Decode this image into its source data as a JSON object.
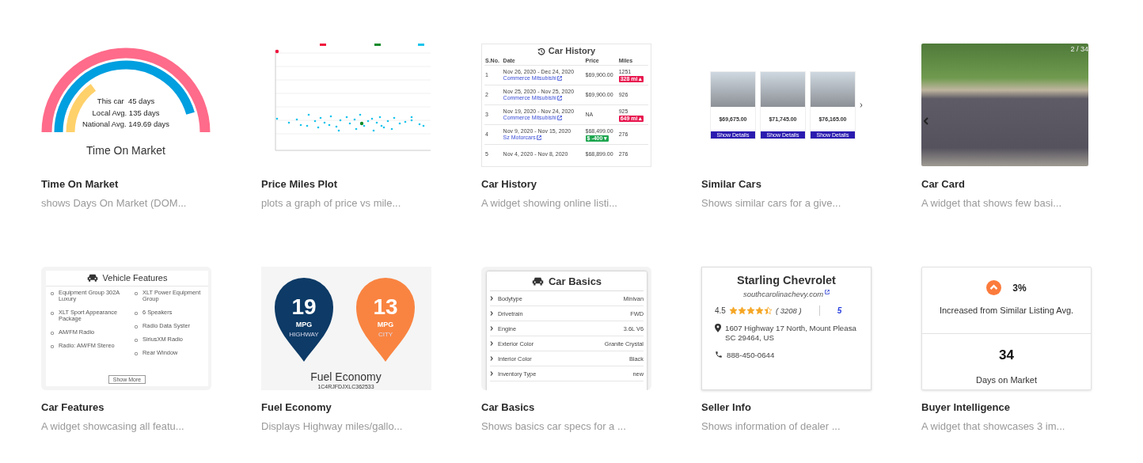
{
  "cards": [
    {
      "title": "Time On Market",
      "description": "shows Days On Market (DOM...",
      "preview": {
        "kind": "gauge",
        "lines": [
          "This car  45 days",
          "Local Avg. 135 days",
          "National Avg. 149.69 days"
        ],
        "caption": "Time On Market"
      }
    },
    {
      "title": "Price Miles Plot",
      "description": "plots a graph of price vs mile...",
      "preview": {
        "kind": "scatter"
      }
    },
    {
      "title": "Car History",
      "description": "A widget showing online listi...",
      "preview": {
        "kind": "history",
        "heading": "Car History",
        "columns": [
          "S.No.",
          "Date",
          "Price",
          "Miles"
        ],
        "rows": [
          {
            "no": "1",
            "date": "Nov 26, 2020 - Dec 24, 2020",
            "dealer": "Commerce Mitsubishi",
            "price": "$69,900.00",
            "miles": "1251",
            "miles_badge": {
              "text": "328 mi ▴",
              "color": "#e8174f"
            }
          },
          {
            "no": "2",
            "date": "Nov 25, 2020 - Nov 25, 2020",
            "dealer": "Commerce Mitsubishi",
            "price": "$69,900.00",
            "miles": "926"
          },
          {
            "no": "3",
            "date": "Nov 19, 2020 - Nov 24, 2020",
            "dealer": "Commerce Mitsubishi",
            "price": "NA",
            "miles": "925",
            "miles_badge": {
              "text": "649 mi ▴",
              "color": "#e8174f"
            }
          },
          {
            "no": "4",
            "date": "Nov 9, 2020 - Nov 15, 2020",
            "dealer": "Sz Motorcars",
            "price": "$68,499.00",
            "miles": "276",
            "price_badge": {
              "text": "$ -400 ▾",
              "color": "#1ea650"
            }
          },
          {
            "no": "5",
            "date": "Nov 4, 2020 - Nov 8, 2020",
            "price": "$68,899.00",
            "miles": "276"
          }
        ]
      }
    },
    {
      "title": "Similar Cars",
      "description": "Shows similar cars for a give...",
      "preview": {
        "kind": "similar",
        "cars": [
          {
            "price": "$69,675.00",
            "button": "Show Details"
          },
          {
            "price": "$71,745.00",
            "button": "Show Details"
          },
          {
            "price": "$76,165.00",
            "button": "Show Details"
          }
        ]
      }
    },
    {
      "title": "Car Card",
      "description": "A widget that shows few basi...",
      "preview": {
        "kind": "photo",
        "counter": "2 / 34"
      }
    },
    {
      "title": "Car Features",
      "description": "A widget showcasing all featu...",
      "preview": {
        "kind": "features",
        "heading": "Vehicle Features",
        "columns": [
          [
            "Equipment Group 302A Luxury",
            "XLT Sport Appearance Package",
            "AM/FM Radio",
            "Radio: AM/FM Stereo"
          ],
          [
            "XLT Power Equipment Group",
            "6 Speakers",
            "Radio Data Syster",
            "SiriusXM Radio",
            "Rear Window"
          ]
        ],
        "button": "Show More"
      }
    },
    {
      "title": "Fuel Economy",
      "description": "Displays Highway miles/gallo...",
      "preview": {
        "kind": "fuel",
        "pins": [
          {
            "value": "19",
            "unit": "MPG",
            "label": "HIGHWAY",
            "color": "#0d3a66"
          },
          {
            "value": "13",
            "unit": "MPG",
            "label": "CITY",
            "color": "#f98441"
          }
        ],
        "caption": "Fuel Economy",
        "vin": "1C4RJFDJXLC362533"
      }
    },
    {
      "title": "Car Basics",
      "description": "Shows basics car specs for a ...",
      "preview": {
        "kind": "basics",
        "heading": "Car Basics",
        "rows": [
          {
            "label": "Bodytype",
            "value": "Minivan"
          },
          {
            "label": "Drivetrain",
            "value": "FWD"
          },
          {
            "label": "Engine",
            "value": "3.6L V6"
          },
          {
            "label": "Exterior Color",
            "value": "Granite Crystal"
          },
          {
            "label": "Interior Color",
            "value": "Black"
          },
          {
            "label": "Inventory Type",
            "value": "new"
          }
        ]
      }
    },
    {
      "title": "Seller Info",
      "description": "Shows information of dealer ...",
      "preview": {
        "kind": "seller",
        "name": "Starling Chevrolet",
        "website": "southcarolinachevy.com",
        "rating": "4.5",
        "stars": 4.5,
        "reviews": "( 3208 )",
        "more": "5",
        "address": "1607 Highway 17 North, Mount Pleasa",
        "address_line2": "SC 29464, US",
        "phone": "888-450-0644"
      }
    },
    {
      "title": "Buyer Intelligence",
      "description": "A widget that showcases 3 im...",
      "preview": {
        "kind": "intel",
        "change": "3%",
        "change_label": "Increased from Similar Listing Avg.",
        "days": "34",
        "days_label": "Days on Market"
      }
    }
  ]
}
